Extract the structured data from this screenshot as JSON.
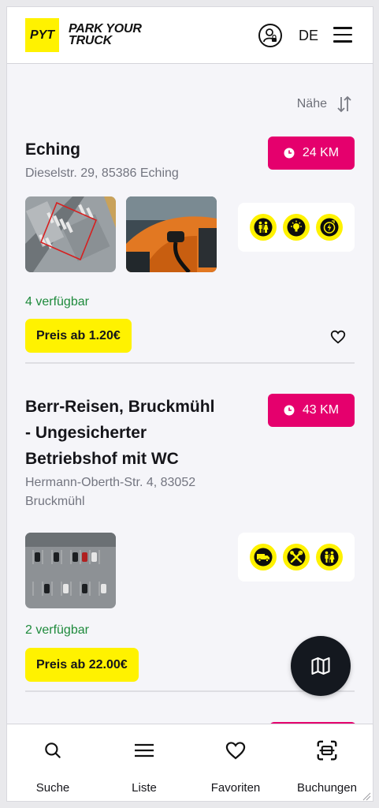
{
  "header": {
    "logo_mark": "PYT",
    "brand_line1": "PARK YOUR",
    "brand_line2": "TRUCK",
    "language": "DE"
  },
  "sort": {
    "label": "Nähe"
  },
  "listings": [
    {
      "title": "Eching",
      "address": "Dieselstr. 29, 85386 Eching",
      "distance": "24 KM",
      "availability": "4 verfügbar",
      "price": "Preis ab 1.20€",
      "amenities": [
        "restroom-icon",
        "lighting-icon",
        "charging-icon"
      ]
    },
    {
      "title_lines": [
        "Berr-Reisen, Bruckmühl",
        "- Ungesicherter",
        "Betriebshof mit WC"
      ],
      "address_lines": [
        "Hermann-Oberth-Str. 4, 83052",
        "Bruckmühl"
      ],
      "distance": "43 KM",
      "availability": "2 verfügbar",
      "price": "Preis ab 22.00€",
      "amenities": [
        "truck-icon",
        "repair-tools-icon",
        "restroom-icon"
      ]
    }
  ],
  "nav": {
    "items": [
      {
        "label": "Suche",
        "icon": "search-icon"
      },
      {
        "label": "Liste",
        "icon": "list-icon"
      },
      {
        "label": "Favoriten",
        "icon": "heart-icon"
      },
      {
        "label": "Buchungen",
        "icon": "bookings-icon"
      }
    ]
  },
  "colors": {
    "accent_yellow": "#fff200",
    "badge_pink": "#e5006d",
    "availability_green": "#1e8a3c",
    "fab_dark": "#14181f"
  }
}
